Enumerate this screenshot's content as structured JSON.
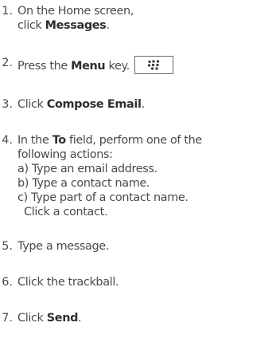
{
  "steps": [
    {
      "number": "1.",
      "line1_text": "On the Home screen,",
      "line2_text": "click ",
      "line2_bold": "Messages",
      "line2_tail": "."
    },
    {
      "number": "2.",
      "text_before": "Press the ",
      "bold": "Menu",
      "text_after": " key.",
      "icon": "blackberry-menu-key-icon"
    },
    {
      "number": "3.",
      "text_before": "Click ",
      "bold": "Compose Email",
      "text_after": "."
    },
    {
      "number": "4.",
      "text_before": "In the ",
      "bold": "To",
      "text_after": " field, perform one of the",
      "line2": "following actions:",
      "options": [
        "a) Type an email address.",
        "b) Type a contact name.",
        "c) Type part of a contact name."
      ],
      "option_c_continuation": "Click a contact."
    },
    {
      "number": "5.",
      "text": "Type a message."
    },
    {
      "number": "6.",
      "text": "Click the trackball."
    },
    {
      "number": "7.",
      "text_before": "Click ",
      "bold": "Send",
      "text_after": "."
    }
  ]
}
